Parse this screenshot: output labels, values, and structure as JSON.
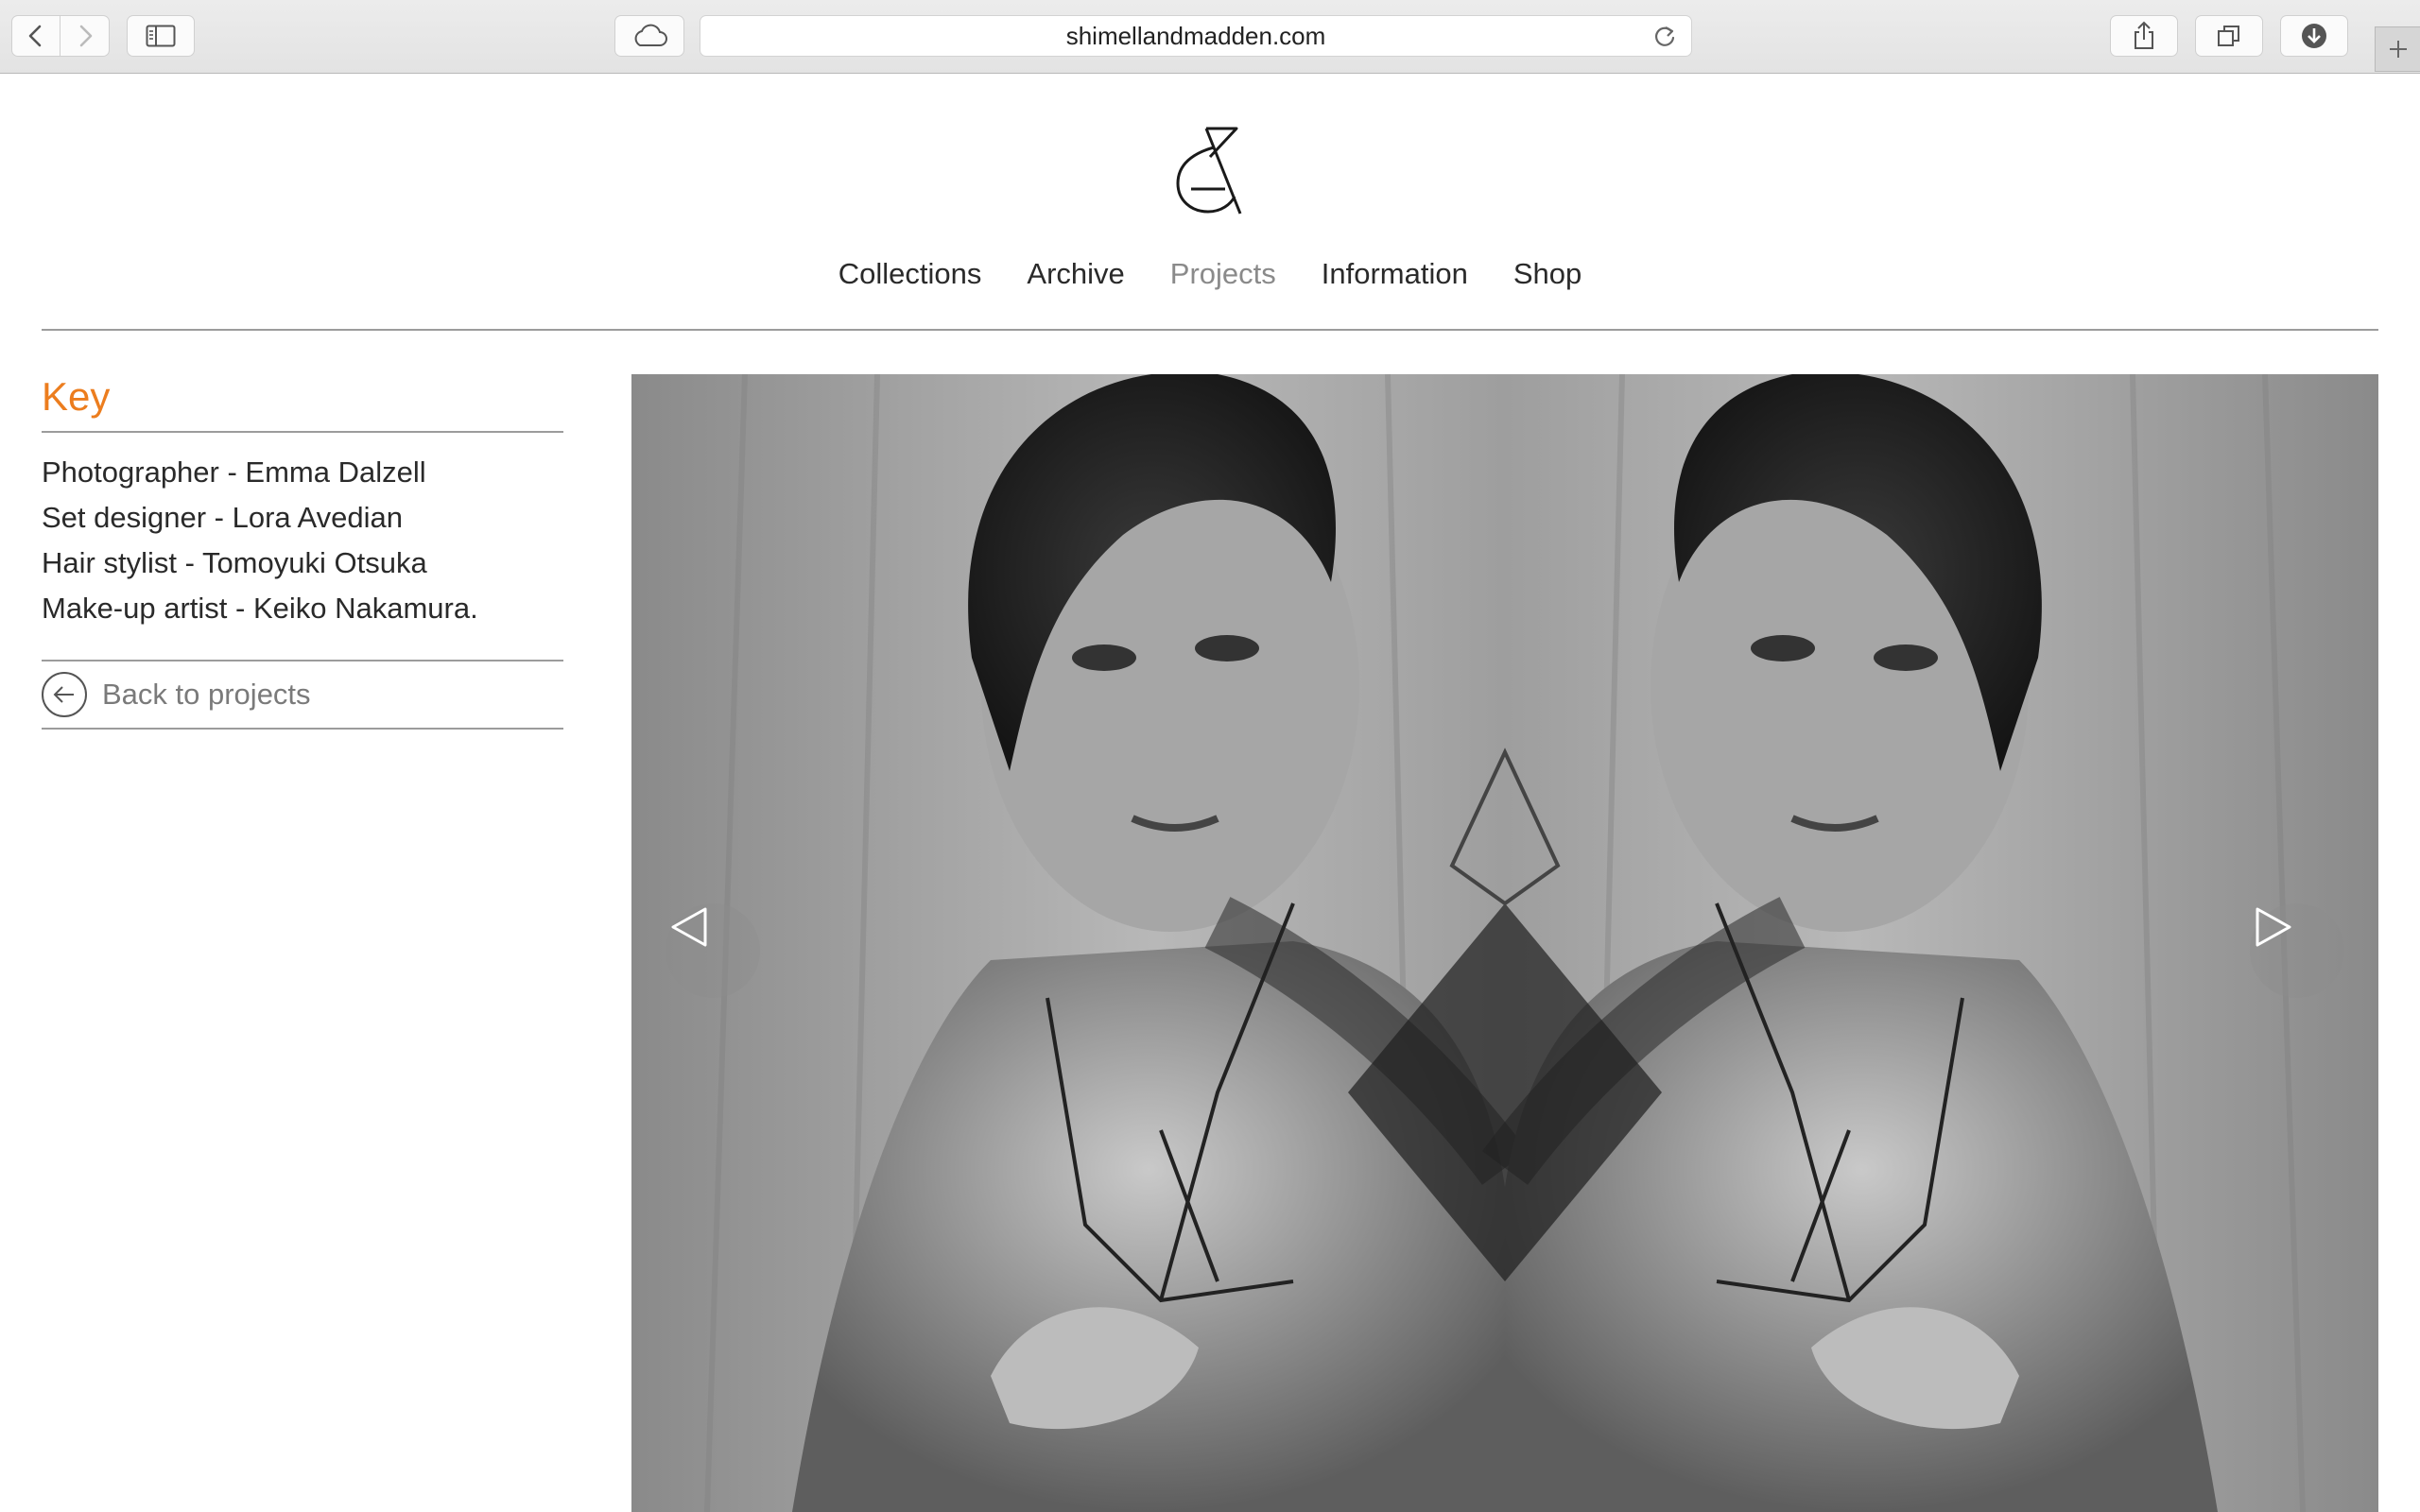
{
  "browser": {
    "url": "shimellandmadden.com",
    "icons": {
      "back": "chevron-left-icon",
      "forward": "chevron-right-icon",
      "sidebar": "sidebar-icon",
      "icloud": "cloud-icon",
      "reload": "reload-icon",
      "share": "share-icon",
      "tabs": "tabs-overview-icon",
      "download": "download-icon",
      "new_tab": "plus-icon"
    }
  },
  "site": {
    "logo": "ampersand-logo",
    "nav": [
      {
        "label": "Collections",
        "active": false
      },
      {
        "label": "Archive",
        "active": false
      },
      {
        "label": "Projects",
        "active": true
      },
      {
        "label": "Information",
        "active": false
      },
      {
        "label": "Shop",
        "active": false
      }
    ]
  },
  "sidebar": {
    "title": "Key",
    "credits": [
      "Photographer - Emma Dalzell",
      "Set designer - Lora Avedian",
      "Hair stylist - Tomoyuki Otsuka",
      "Make-up artist - Keiko Nakamura."
    ],
    "back_label": "Back to projects"
  },
  "gallery": {
    "image": "mirrored black-and-white fashion photograph",
    "prev": "triangle-left-icon",
    "next": "triangle-right-icon"
  },
  "colors": {
    "accent": "#ec7d1e",
    "nav_active": "#8a8a8a",
    "text": "#2a2a2a"
  }
}
